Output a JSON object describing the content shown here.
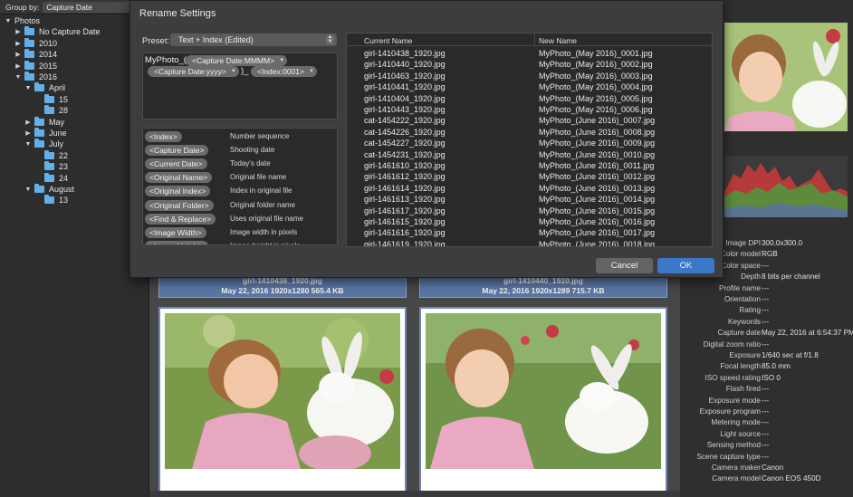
{
  "sidebar": {
    "group_by_label": "Group by:",
    "group_by_value": "Capture Date",
    "tree": [
      {
        "label": "Photos",
        "tri": "▼"
      },
      {
        "label": "No Capture Date",
        "tri": "▶"
      },
      {
        "label": "2010",
        "tri": "▶"
      },
      {
        "label": "2014",
        "tri": "▶"
      },
      {
        "label": "2015",
        "tri": "▶"
      },
      {
        "label": "2016",
        "tri": "▼"
      },
      {
        "label": "April",
        "tri": "▼"
      },
      {
        "label": "15",
        "tri": ""
      },
      {
        "label": "28",
        "tri": ""
      },
      {
        "label": "May",
        "tri": "▶"
      },
      {
        "label": "June",
        "tri": "▶"
      },
      {
        "label": "July",
        "tri": "▼"
      },
      {
        "label": "22",
        "tri": ""
      },
      {
        "label": "23",
        "tri": ""
      },
      {
        "label": "24",
        "tri": ""
      },
      {
        "label": "August",
        "tri": "▼"
      },
      {
        "label": "13",
        "tri": ""
      }
    ]
  },
  "grid": {
    "cards": [
      {
        "name": "girl-1410438_1920.jpg",
        "info": "May 22, 2016  1920x1280  565.4 KB"
      },
      {
        "name": "girl-1410440_1920.jpg",
        "info": "May 22, 2016  1920x1289  715.7 KB"
      }
    ]
  },
  "dialog": {
    "title": "Rename Settings",
    "preset_label": "Preset:",
    "preset_value": "Text + Index (Edited)",
    "pattern": {
      "text1": "MyPhoto_(",
      "token1": "<Capture Date:MMMM>",
      "token2": "<Capture Date:yyyy>",
      "text2": ")_",
      "token3": "<Index:0001>"
    },
    "tokens": [
      {
        "token": "<Index>",
        "desc": "Number sequence"
      },
      {
        "token": "<Capture Date>",
        "desc": "Shooting date"
      },
      {
        "token": "<Current Date>",
        "desc": "Today's date"
      },
      {
        "token": "<Original Name>",
        "desc": "Original file name"
      },
      {
        "token": "<Original Index>",
        "desc": "Index in original file"
      },
      {
        "token": "<Original Folder>",
        "desc": "Original folder name"
      },
      {
        "token": "<Find & Replace>",
        "desc": "Uses original file name"
      },
      {
        "token": "<Image Width>",
        "desc": "Image width in pixels"
      },
      {
        "token": "<Image Height>",
        "desc": "Image height in pixels"
      }
    ],
    "table": {
      "col_current": "Current Name",
      "col_new": "New Name",
      "rows": [
        [
          "girl-1410438_1920.jpg",
          "MyPhoto_(May 2016)_0001.jpg"
        ],
        [
          "girl-1410440_1920.jpg",
          "MyPhoto_(May 2016)_0002.jpg"
        ],
        [
          "girl-1410463_1920.jpg",
          "MyPhoto_(May 2016)_0003.jpg"
        ],
        [
          "girl-1410441_1920.jpg",
          "MyPhoto_(May 2016)_0004.jpg"
        ],
        [
          "girl-1410404_1920.jpg",
          "MyPhoto_(May 2016)_0005.jpg"
        ],
        [
          "girl-1410443_1920.jpg",
          "MyPhoto_(May 2016)_0006.jpg"
        ],
        [
          "cat-1454222_1920.jpg",
          "MyPhoto_(June 2016)_0007.jpg"
        ],
        [
          "cat-1454226_1920.jpg",
          "MyPhoto_(June 2016)_0008.jpg"
        ],
        [
          "cat-1454227_1920.jpg",
          "MyPhoto_(June 2016)_0009.jpg"
        ],
        [
          "cat-1454231_1920.jpg",
          "MyPhoto_(June 2016)_0010.jpg"
        ],
        [
          "girl-1461610_1920.jpg",
          "MyPhoto_(June 2016)_0011.jpg"
        ],
        [
          "girl-1461612_1920.jpg",
          "MyPhoto_(June 2016)_0012.jpg"
        ],
        [
          "girl-1461614_1920.jpg",
          "MyPhoto_(June 2016)_0013.jpg"
        ],
        [
          "girl-1461613_1920.jpg",
          "MyPhoto_(June 2016)_0014.jpg"
        ],
        [
          "girl-1461617_1920.jpg",
          "MyPhoto_(June 2016)_0015.jpg"
        ],
        [
          "girl-1461615_1920.jpg",
          "MyPhoto_(June 2016)_0016.jpg"
        ],
        [
          "girl-1461616_1920.jpg",
          "MyPhoto_(June 2016)_0017.jpg"
        ],
        [
          "girl-1461619_1920.jpg",
          "MyPhoto_(June 2016)_0018.jpg"
        ]
      ]
    },
    "cancel_label": "Cancel",
    "ok_label": "OK"
  },
  "metadata": [
    {
      "k": "Image DPI",
      "v": "300.0x300.0"
    },
    {
      "k": "Color model",
      "v": "RGB"
    },
    {
      "k": "Color space",
      "v": "---"
    },
    {
      "k": "Depth",
      "v": "8 bits per channel"
    },
    {
      "k": "Profile name",
      "v": "---"
    },
    {
      "k": "Orientation",
      "v": "---"
    },
    {
      "k": "Rating",
      "v": "---"
    },
    {
      "k": "Keywords",
      "v": "---"
    },
    {
      "k": "Capture date",
      "v": "May 22, 2016 at 6:54:37 PM"
    },
    {
      "k": "Digital zoom ratio",
      "v": "---"
    },
    {
      "k": "Exposure",
      "v": "1/640 sec at f/1.8"
    },
    {
      "k": "Focal length",
      "v": "85.0 mm"
    },
    {
      "k": "ISO speed rating",
      "v": "ISO 0"
    },
    {
      "k": "Flash fired",
      "v": "---"
    },
    {
      "k": "Exposure mode",
      "v": "---"
    },
    {
      "k": "Exposure program",
      "v": "---"
    },
    {
      "k": "Metering mode",
      "v": "---"
    },
    {
      "k": "Light source",
      "v": "---"
    },
    {
      "k": "Sensing method",
      "v": "---"
    },
    {
      "k": "Scene capture type",
      "v": "---"
    },
    {
      "k": "Camera maker",
      "v": "Canon"
    },
    {
      "k": "Camera model",
      "v": "Canon EOS 450D"
    }
  ]
}
